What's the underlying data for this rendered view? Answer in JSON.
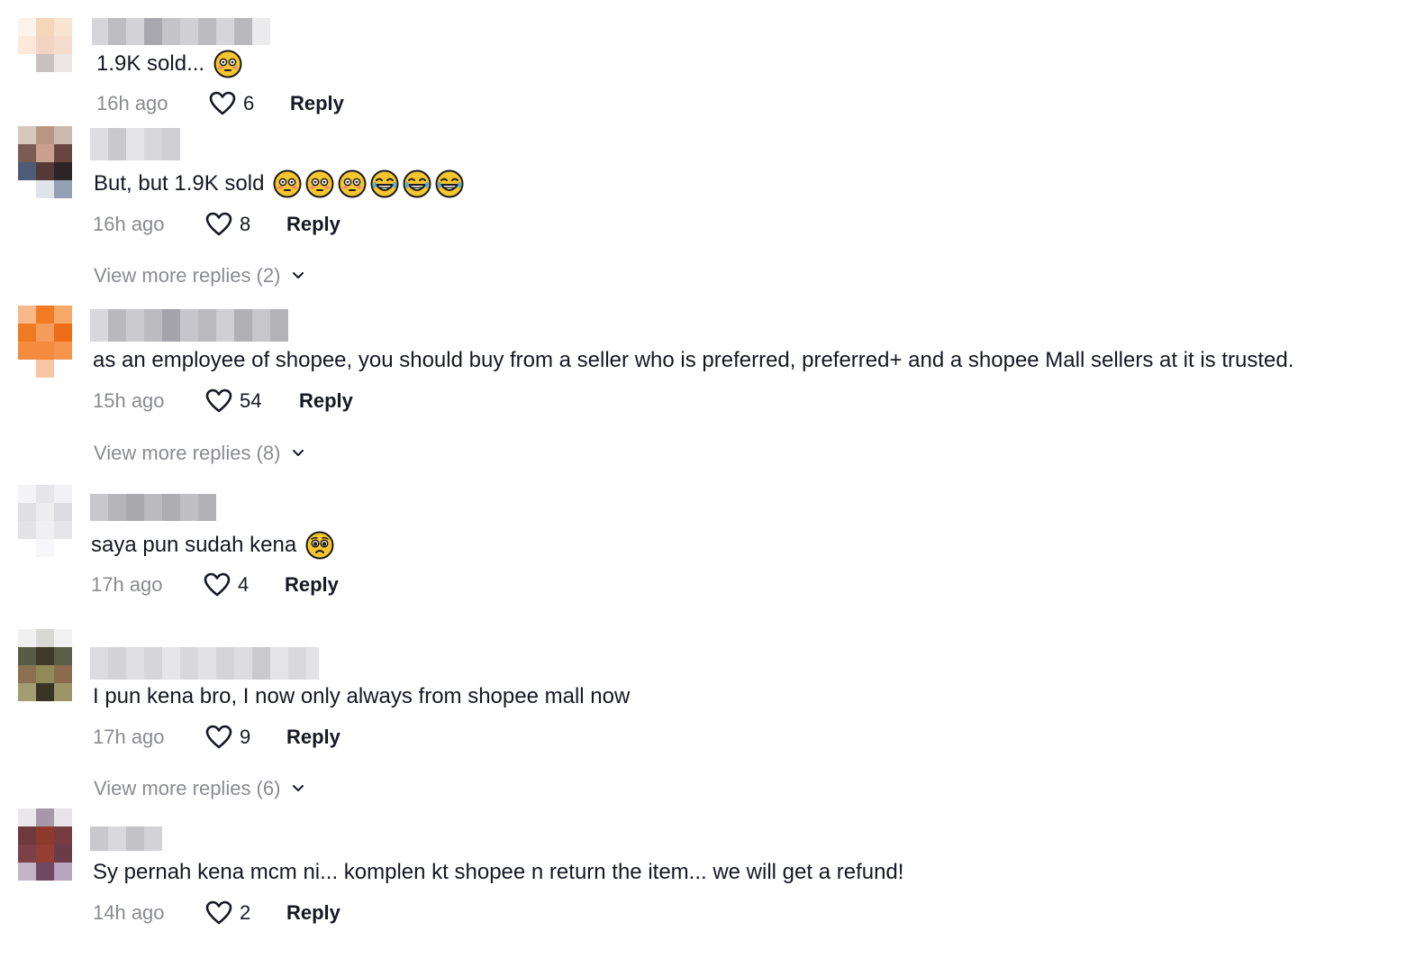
{
  "comments": [
    {
      "text": "1.9K sold...",
      "emojis": [
        "flushed-face-emoji"
      ],
      "time": "16h ago",
      "likes": "6",
      "reply_label": "Reply"
    },
    {
      "text": "But, but 1.9K sold",
      "emojis": [
        "flushed-face-emoji",
        "flushed-face-emoji",
        "flushed-face-emoji",
        "tears-of-joy-emoji",
        "tears-of-joy-emoji",
        "tears-of-joy-emoji"
      ],
      "time": "16h ago",
      "likes": "8",
      "reply_label": "Reply",
      "more_replies": "View more replies (2)"
    },
    {
      "text": "as an employee of shopee, you should buy from a seller who is preferred, preferred+ and a shopee Mall sellers at it is trusted.",
      "emojis": [],
      "time": "15h ago",
      "likes": "54",
      "reply_label": "Reply",
      "more_replies": "View more replies (8)"
    },
    {
      "text": "saya pun sudah kena",
      "emojis": [
        "pleading-face-emoji"
      ],
      "time": "17h ago",
      "likes": "4",
      "reply_label": "Reply"
    },
    {
      "text": "I pun kena bro, I now only always from shopee mall now",
      "emojis": [],
      "time": "17h ago",
      "likes": "9",
      "reply_label": "Reply",
      "more_replies": "View more replies (6)"
    },
    {
      "text": "Sy pernah kena mcm ni... komplen kt shopee n return the item... we will get a refund!",
      "emojis": [],
      "time": "14h ago",
      "likes": "2",
      "reply_label": "Reply"
    }
  ],
  "icons": {
    "like": "heart-outline-icon",
    "expand": "chevron-down-icon"
  },
  "colors": {
    "text": "#161823",
    "secondary": "#8a8b91",
    "emoji_face": "#f7c62f"
  }
}
